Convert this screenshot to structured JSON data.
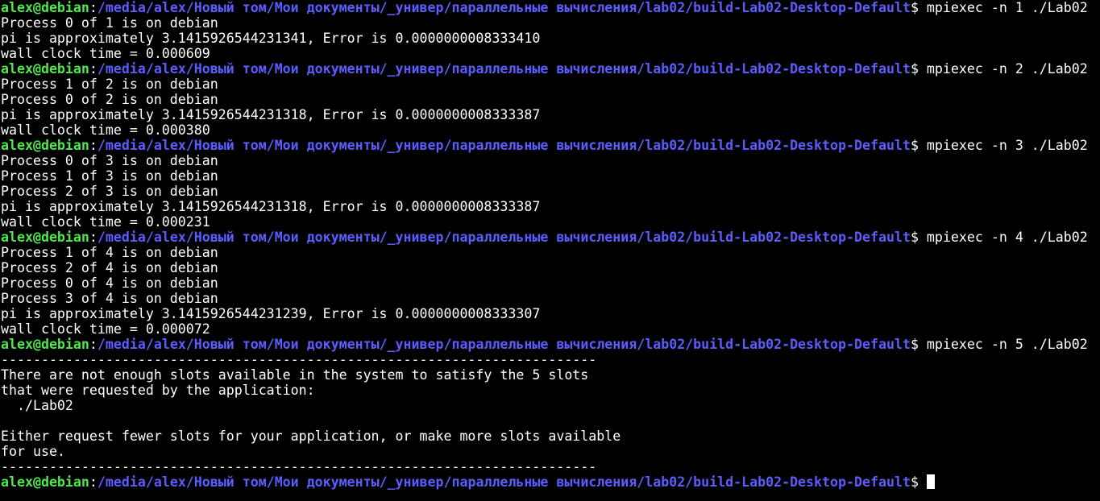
{
  "prompt": {
    "user_host": "alex@debian",
    "colon": ":",
    "path": "/media/alex/Новый том/Мои документы/_универ/параллельные вычисления/lab02/build-Lab02-Desktop-Default",
    "symbol": "$ "
  },
  "colors": {
    "user": "#4fe84f",
    "path": "#5c5cff",
    "text": "#ffffff",
    "background": "#000000"
  },
  "lines": [
    {
      "type": "prompt",
      "command": "mpiexec -n 1 ./Lab02"
    },
    {
      "type": "out",
      "text": "Process 0 of 1 is on debian"
    },
    {
      "type": "out",
      "text": "pi is approximately 3.1415926544231341, Error is 0.0000000008333410"
    },
    {
      "type": "out",
      "text": "wall clock time = 0.000609"
    },
    {
      "type": "prompt",
      "command": "mpiexec -n 2 ./Lab02"
    },
    {
      "type": "out",
      "text": "Process 1 of 2 is on debian"
    },
    {
      "type": "out",
      "text": "Process 0 of 2 is on debian"
    },
    {
      "type": "out",
      "text": "pi is approximately 3.1415926544231318, Error is 0.0000000008333387"
    },
    {
      "type": "out",
      "text": "wall clock time = 0.000380"
    },
    {
      "type": "prompt",
      "command": "mpiexec -n 3 ./Lab02"
    },
    {
      "type": "out",
      "text": "Process 0 of 3 is on debian"
    },
    {
      "type": "out",
      "text": "Process 1 of 3 is on debian"
    },
    {
      "type": "out",
      "text": "Process 2 of 3 is on debian"
    },
    {
      "type": "out",
      "text": "pi is approximately 3.1415926544231318, Error is 0.0000000008333387"
    },
    {
      "type": "out",
      "text": "wall clock time = 0.000231"
    },
    {
      "type": "prompt",
      "command": "mpiexec -n 4 ./Lab02"
    },
    {
      "type": "out",
      "text": "Process 1 of 4 is on debian"
    },
    {
      "type": "out",
      "text": "Process 2 of 4 is on debian"
    },
    {
      "type": "out",
      "text": "Process 0 of 4 is on debian"
    },
    {
      "type": "out",
      "text": "Process 3 of 4 is on debian"
    },
    {
      "type": "out",
      "text": "pi is approximately 3.1415926544231239, Error is 0.0000000008333307"
    },
    {
      "type": "out",
      "text": "wall clock time = 0.000072"
    },
    {
      "type": "prompt",
      "command": "mpiexec -n 5 ./Lab02"
    },
    {
      "type": "out",
      "text": "--------------------------------------------------------------------------"
    },
    {
      "type": "out",
      "text": "There are not enough slots available in the system to satisfy the 5 slots"
    },
    {
      "type": "out",
      "text": "that were requested by the application:"
    },
    {
      "type": "out",
      "text": "  ./Lab02"
    },
    {
      "type": "out",
      "text": ""
    },
    {
      "type": "out",
      "text": "Either request fewer slots for your application, or make more slots available"
    },
    {
      "type": "out",
      "text": "for use."
    },
    {
      "type": "out",
      "text": "--------------------------------------------------------------------------"
    },
    {
      "type": "prompt",
      "command": "",
      "cursor": true
    }
  ]
}
